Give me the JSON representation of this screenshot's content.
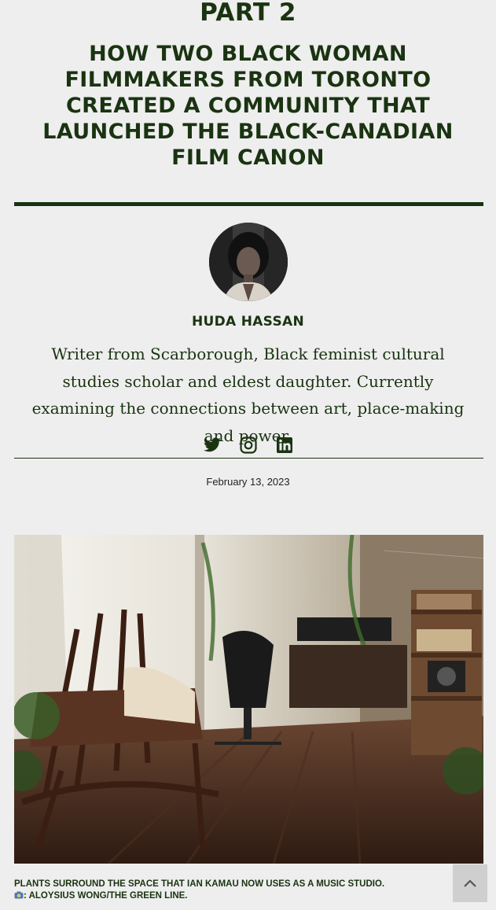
{
  "article": {
    "kicker": "PART 2",
    "title": "HOW TWO BLACK WOMAN FILMMAKERS FROM TORONTO CREATED A COMMUNITY THAT LAUNCHED THE BLACK-CANADIAN FILM CANON",
    "date": "February 13, 2023"
  },
  "author": {
    "name": "HUDA HASSAN",
    "bio": "Writer from Scarborough, Black feminist cultural studies scholar and eldest daughter. Currently examining the connections between art, place-making and power.",
    "social": [
      "twitter-icon",
      "instagram-icon",
      "linkedin-icon"
    ]
  },
  "photo": {
    "caption": "PLANTS SURROUND THE SPACE THAT IAN KAMAU NOW USES AS A MUSIC STUDIO.",
    "credit": ": ALOYSIUS WONG/THE GREEN LINE."
  },
  "colors": {
    "text": "#1a3311",
    "background": "#eeeeee",
    "scroll_button": "#cfcfcf"
  }
}
